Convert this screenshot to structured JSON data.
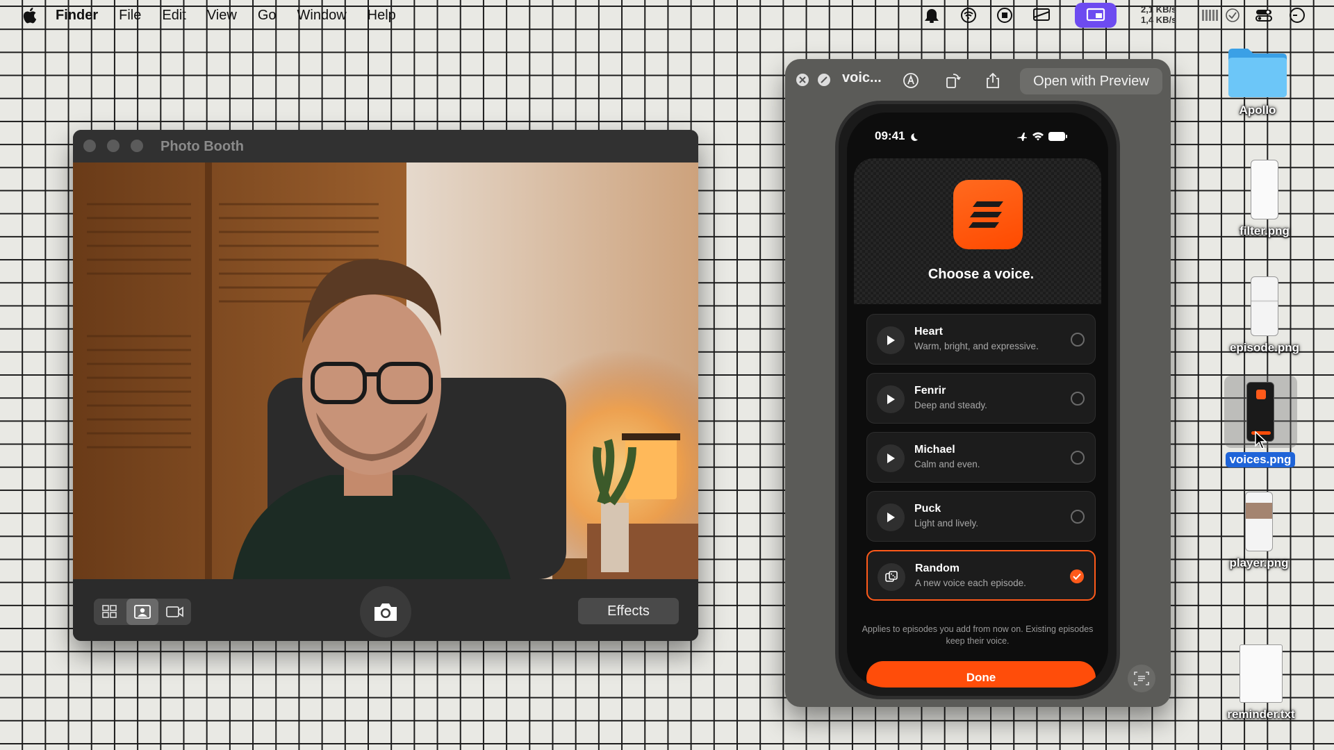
{
  "menubar": {
    "apple_icon": "apple-logo-icon",
    "items": [
      "Finder",
      "File",
      "Edit",
      "View",
      "Go",
      "Window",
      "Help"
    ],
    "status": {
      "net_up": "2,1 KB/s",
      "net_down": "1,4 KB/s",
      "accent": "#6d4bf0"
    }
  },
  "photobooth": {
    "title": "Photo Booth",
    "effects_label": "Effects",
    "modes": [
      "grid-icon",
      "portrait-icon",
      "video-icon"
    ]
  },
  "quicklook": {
    "title": "voic...",
    "open_with_label": "Open with Preview"
  },
  "phone": {
    "time": "09:41",
    "heading": "Choose a voice.",
    "voices": [
      {
        "name": "Heart",
        "desc": "Warm, bright, and expressive.",
        "selected": false
      },
      {
        "name": "Fenrir",
        "desc": "Deep and steady.",
        "selected": false
      },
      {
        "name": "Michael",
        "desc": "Calm and even.",
        "selected": false
      },
      {
        "name": "Puck",
        "desc": "Light and lively.",
        "selected": false
      },
      {
        "name": "Random",
        "desc": "A new voice each episode.",
        "selected": true
      }
    ],
    "footnote": "Applies to episodes you add from now on. Existing episodes keep their voice.",
    "done_label": "Done",
    "accent": "#ff4d0a"
  },
  "desktop": {
    "items": [
      {
        "label": "Apollo",
        "kind": "folder"
      },
      {
        "label": "filter.png",
        "kind": "image"
      },
      {
        "label": "episode.png",
        "kind": "image"
      },
      {
        "label": "voices.png",
        "kind": "image",
        "selected": true
      },
      {
        "label": "player.png",
        "kind": "image"
      },
      {
        "label": "reminder.txt",
        "kind": "text"
      }
    ]
  }
}
